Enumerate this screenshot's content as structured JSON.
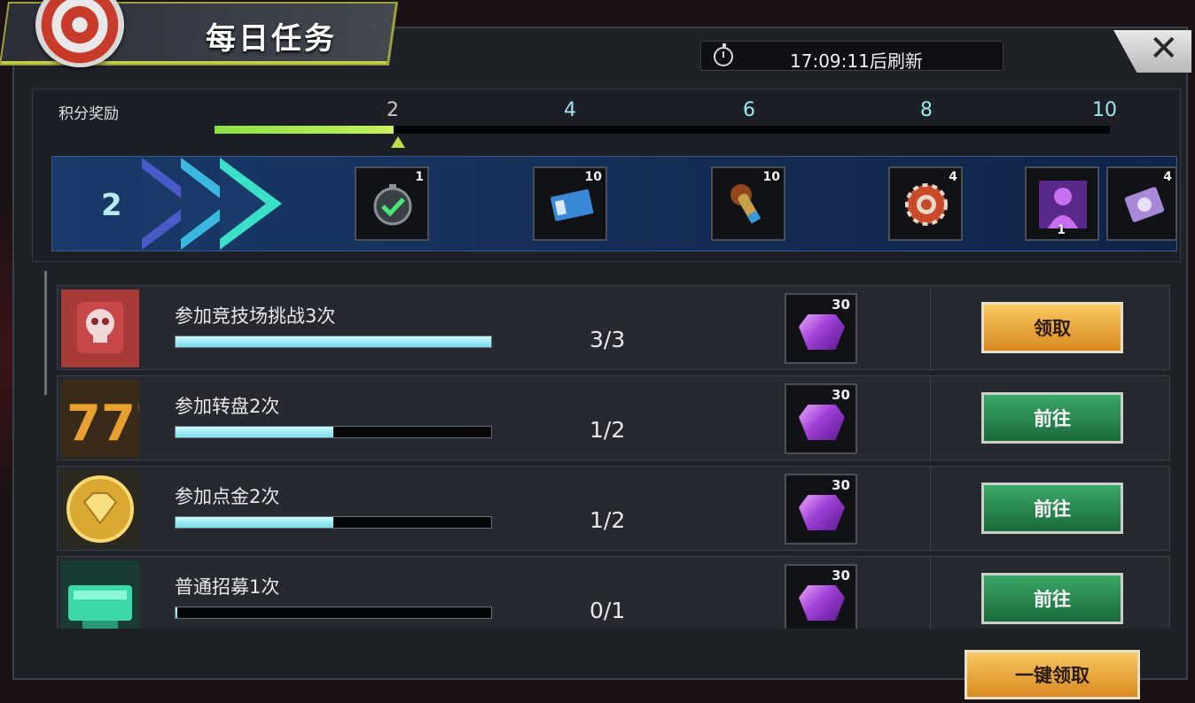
{
  "header": {
    "title": "每日任务",
    "refresh_timer": "17:09:11后刷新",
    "close_label": "✕"
  },
  "progress": {
    "label": "积分奖励",
    "current_points": "2",
    "max_points": 10,
    "fill_fraction": 0.2,
    "ticks": [
      "2",
      "4",
      "6",
      "8",
      "10"
    ]
  },
  "milestone_rewards": [
    {
      "icon": "stopwatch-check-icon",
      "count": "1"
    },
    {
      "icon": "cinema-ticket-icon",
      "count": "10"
    },
    {
      "icon": "bullet-icon",
      "count": "10"
    },
    {
      "icon": "casino-chip-icon",
      "count": "4"
    },
    {
      "icon": "hero-silhouette-icon",
      "count": "1"
    },
    {
      "icon": "card-pack-icon",
      "count": "4"
    }
  ],
  "tasks": [
    {
      "name": "参加竞技场挑战3次",
      "progress": "3/3",
      "fraction": 1.0,
      "reward_icon": "purple-gem-icon",
      "reward_count": "30",
      "action": "领取",
      "action_type": "claim",
      "icon": "skull-arena-icon"
    },
    {
      "name": "参加转盘2次",
      "progress": "1/2",
      "fraction": 0.5,
      "reward_icon": "purple-gem-icon",
      "reward_count": "30",
      "action": "前往",
      "action_type": "go",
      "icon": "slot-777-icon"
    },
    {
      "name": "参加点金2次",
      "progress": "1/2",
      "fraction": 0.5,
      "reward_icon": "purple-gem-icon",
      "reward_count": "30",
      "action": "前往",
      "action_type": "go",
      "icon": "gold-diamond-coin-icon"
    },
    {
      "name": "普通招募1次",
      "progress": "0/1",
      "fraction": 0.0,
      "reward_icon": "purple-gem-icon",
      "reward_count": "30",
      "action": "前往",
      "action_type": "go",
      "icon": "recruit-altar-icon"
    }
  ],
  "footer": {
    "claim_all_label": "一键领取"
  },
  "colors": {
    "accent_green": "#8ae048",
    "claim_orange": "#e8a030",
    "go_green": "#2a8a50",
    "progress_cyan": "#7adce8",
    "gem_purple": "#a040d8"
  }
}
